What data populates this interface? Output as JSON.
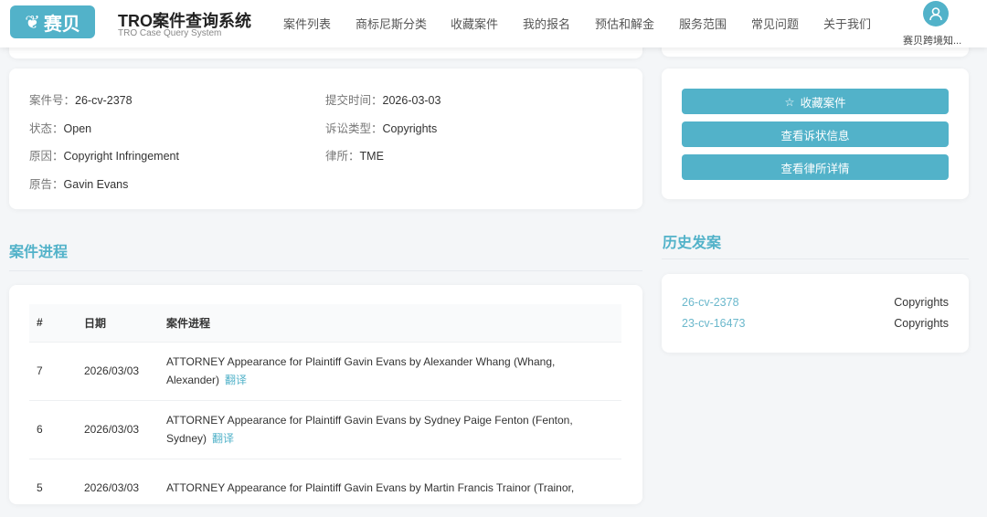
{
  "header": {
    "logo": "赛贝",
    "title": "TRO案件查询系统",
    "subtitle": "TRO Case Query System",
    "nav": [
      "案件列表",
      "商标尼斯分类",
      "收藏案件",
      "我的报名",
      "预估和解金",
      "服务范围",
      "常见问题",
      "关于我们"
    ],
    "user": "赛贝跨境知..."
  },
  "case": {
    "number_label": "案件号：",
    "number": "26-cv-2378",
    "submit_label": "提交时间：",
    "submit": "2026-03-03",
    "status_label": "状态：",
    "status": "Open",
    "type_label": "诉讼类型：",
    "type": "Copyrights",
    "cause_label": "原因：",
    "cause": "Copyright Infringement",
    "firm_label": "律所：",
    "firm": "TME",
    "plaintiff_label": "原告：",
    "plaintiff": "Gavin Evans"
  },
  "actions": {
    "favorite": "收藏案件",
    "complaint": "查看诉状信息",
    "firm": "查看律所详情"
  },
  "progress": {
    "title": "案件进程",
    "headers": [
      "#",
      "日期",
      "案件进程"
    ],
    "translate": "翻译",
    "rows": [
      {
        "n": "7",
        "date": "2026/03/03",
        "text": "ATTORNEY Appearance for Plaintiff Gavin Evans by Alexander Whang (Whang, Alexander)"
      },
      {
        "n": "6",
        "date": "2026/03/03",
        "text": "ATTORNEY Appearance for Plaintiff Gavin Evans by Sydney Paige Fenton (Fenton, Sydney)"
      },
      {
        "n": "5",
        "date": "2026/03/03",
        "text": "ATTORNEY Appearance for Plaintiff Gavin Evans by Martin Francis Trainor (Trainor,"
      }
    ]
  },
  "history": {
    "title": "历史发案",
    "items": [
      {
        "case": "26-cv-2378",
        "type": "Copyrights"
      },
      {
        "case": "23-cv-16473",
        "type": "Copyrights"
      }
    ]
  },
  "colors": {
    "accent": "#52b2c9"
  }
}
